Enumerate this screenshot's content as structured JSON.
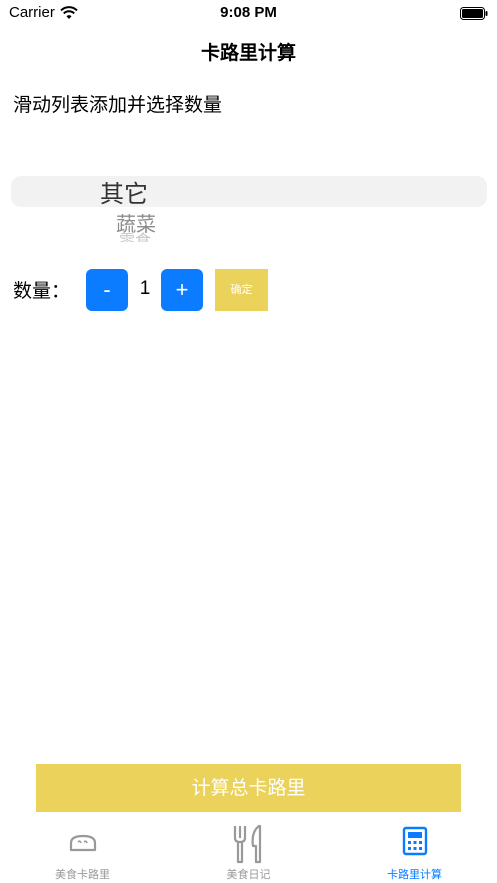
{
  "status_bar": {
    "carrier": "Carrier",
    "time": "9:08 PM"
  },
  "nav": {
    "title": "卡路里计算"
  },
  "instruction": "滑动列表添加并选择数量",
  "picker": {
    "selected": "其它",
    "next": "蔬菜",
    "faded": "零食"
  },
  "quantity": {
    "label": "数量：",
    "minus": "-",
    "value": "1",
    "plus": "+",
    "confirm": "确定"
  },
  "calculate_button": "计算总卡路里",
  "tabs": [
    {
      "label": "美食卡路里",
      "icon": "bread-icon",
      "active": false
    },
    {
      "label": "美食日记",
      "icon": "fork-knife-icon",
      "active": false
    },
    {
      "label": "卡路里计算",
      "icon": "calculator-icon",
      "active": true
    }
  ],
  "colors": {
    "accent_blue": "#0b7cff",
    "accent_yellow": "#ead25b",
    "inactive_tab": "#999999"
  }
}
